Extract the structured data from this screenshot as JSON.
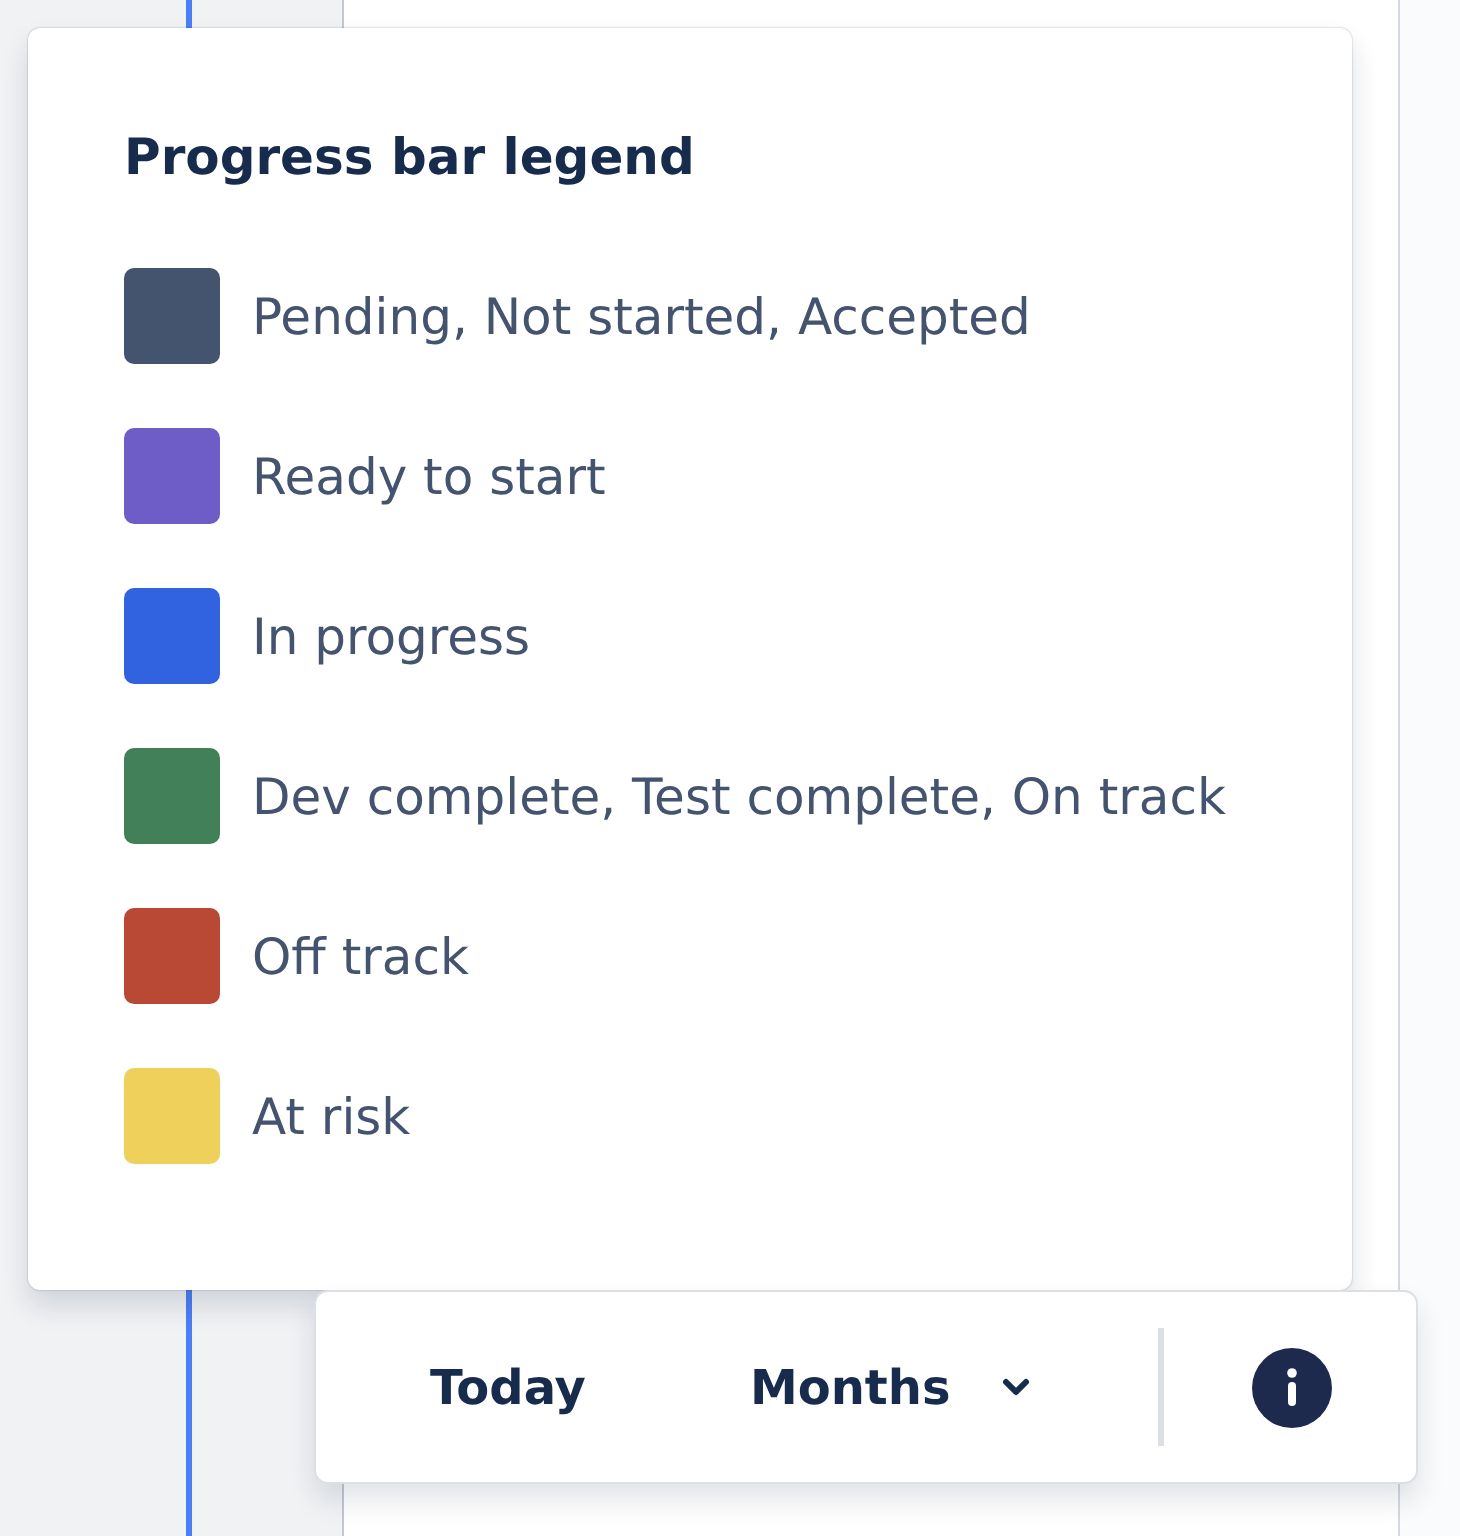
{
  "legend": {
    "title": "Progress bar legend",
    "items": [
      {
        "label": "Pending, Not started, Accepted",
        "color": "#44546f"
      },
      {
        "label": "Ready to start",
        "color": "#6e5dc6"
      },
      {
        "label": "In progress",
        "color": "#3163e0"
      },
      {
        "label": "Dev complete, Test complete, On track",
        "color": "#42805a"
      },
      {
        "label": "Off track",
        "color": "#b94835"
      },
      {
        "label": "At risk",
        "color": "#eed05a"
      }
    ]
  },
  "toolbar": {
    "today_button": "Today",
    "view_dropdown": {
      "value": "Months"
    }
  }
}
